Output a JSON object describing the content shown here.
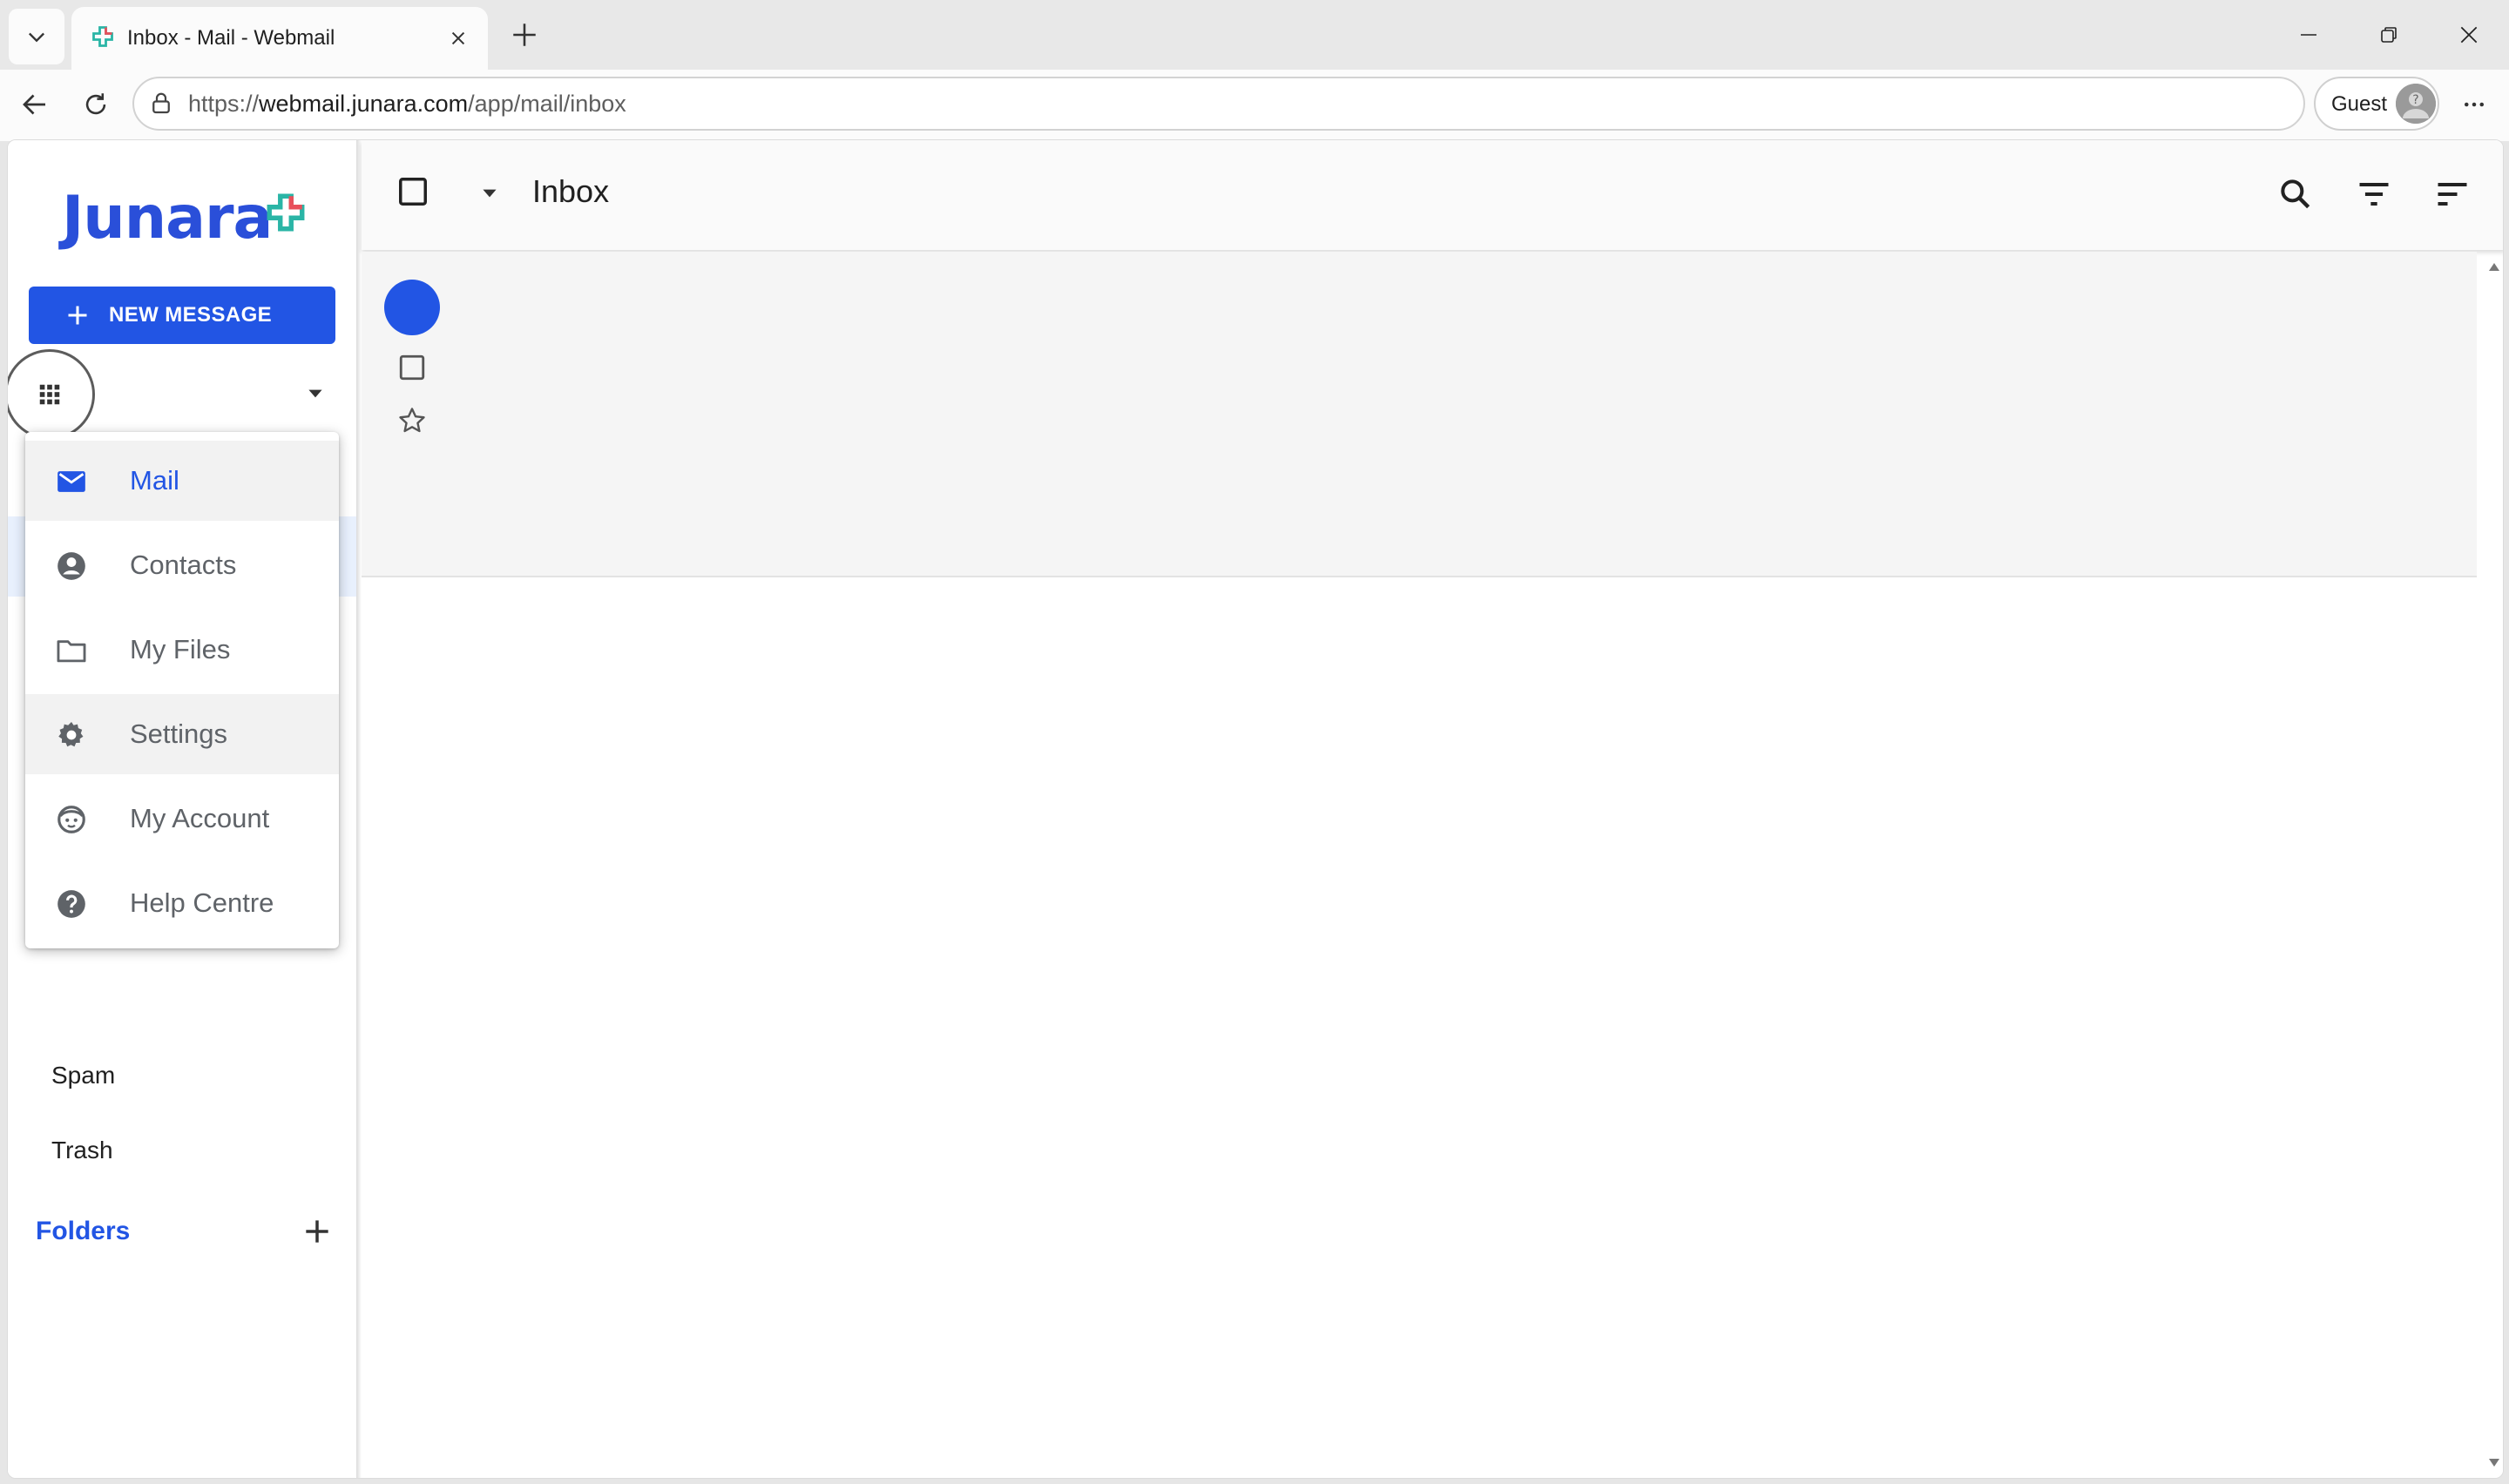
{
  "browser": {
    "tab_title": "Inbox - Mail - Webmail",
    "url_scheme": "https://",
    "url_host": "webmail.junara.com",
    "url_path": "/app/mail/inbox",
    "profile_label": "Guest"
  },
  "app": {
    "logo_text": "Junara",
    "brand_color": "#2255e4",
    "new_message_label": "NEW MESSAGE",
    "app_menu": [
      {
        "label": "Mail",
        "icon": "mail-icon",
        "state": "active"
      },
      {
        "label": "Contacts",
        "icon": "contact-icon",
        "state": "normal"
      },
      {
        "label": "My Files",
        "icon": "folder-icon",
        "state": "normal"
      },
      {
        "label": "Settings",
        "icon": "gear-icon",
        "state": "hover"
      },
      {
        "label": "My Account",
        "icon": "face-icon",
        "state": "normal"
      },
      {
        "label": "Help Centre",
        "icon": "help-icon",
        "state": "normal"
      }
    ],
    "nav_partial": "Spam",
    "nav_trash": "Trash",
    "folders_label": "Folders",
    "folder_title": "Inbox"
  }
}
